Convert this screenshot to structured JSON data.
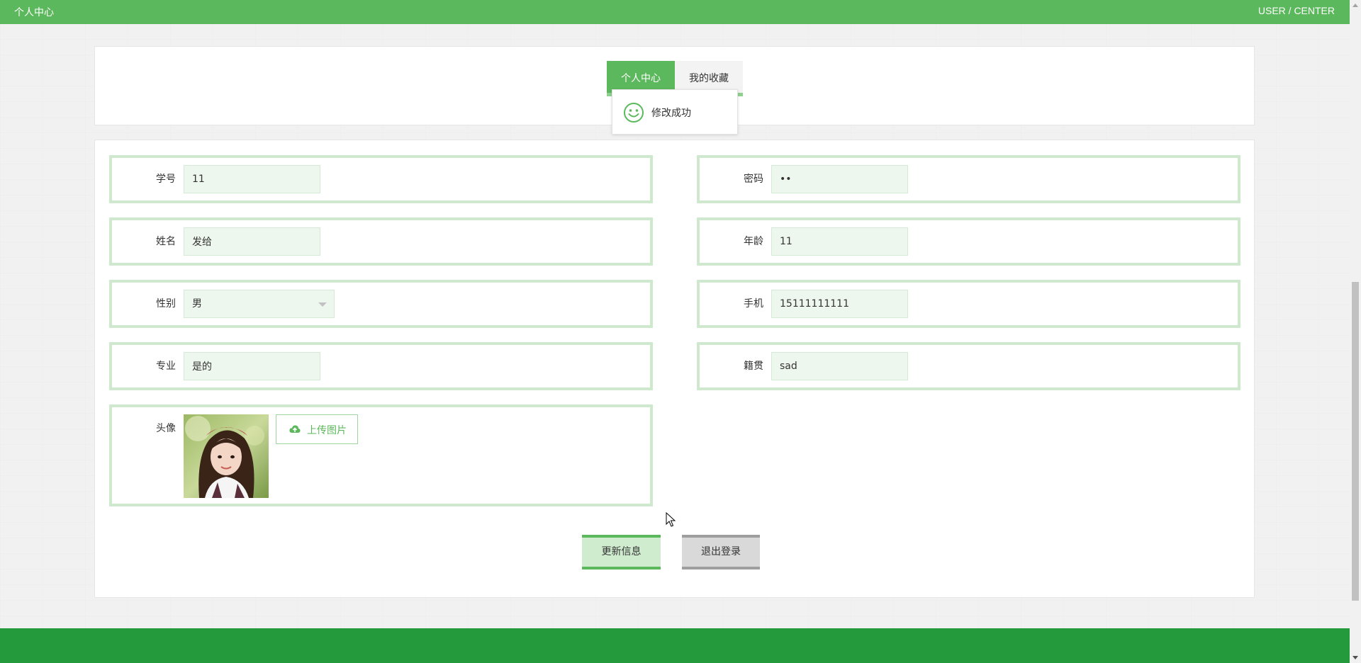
{
  "header": {
    "title": "个人中心",
    "right_label": "USER / CENTER"
  },
  "tabs": [
    {
      "label": "个人中心",
      "active": true
    },
    {
      "label": "我的收藏",
      "active": false
    }
  ],
  "toast": {
    "message": "修改成功",
    "icon": "smile-icon"
  },
  "form": {
    "student_id": {
      "label": "学号",
      "value": "11"
    },
    "password": {
      "label": "密码",
      "value": "••"
    },
    "name": {
      "label": "姓名",
      "value": "发给"
    },
    "age": {
      "label": "年龄",
      "value": "11"
    },
    "gender": {
      "label": "性别",
      "value": "男"
    },
    "phone": {
      "label": "手机",
      "value": "15111111111"
    },
    "major": {
      "label": "专业",
      "value": "是的"
    },
    "hometown": {
      "label": "籍贯",
      "value": "sad"
    },
    "avatar": {
      "label": "头像",
      "upload_label": "上传图片",
      "upload_icon": "cloud-upload-icon"
    }
  },
  "actions": {
    "update_label": "更新信息",
    "logout_label": "退出登录"
  },
  "colors": {
    "primary": "#5cb85c",
    "footer": "#249a3c",
    "field_border": "#cfe9cf",
    "input_bg": "#eef7ee"
  }
}
